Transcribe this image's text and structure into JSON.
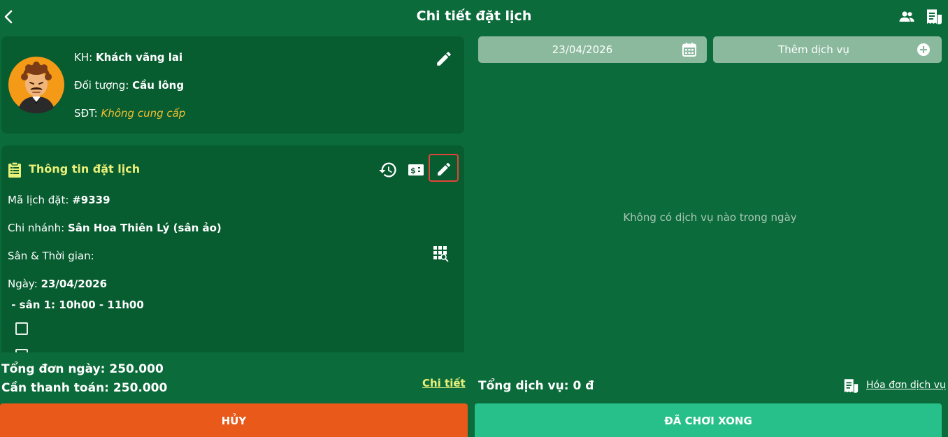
{
  "header": {
    "title": "Chi tiết đặt lịch",
    "icons": [
      "chevron-left-icon",
      "people-icon",
      "receipt-icon"
    ]
  },
  "customer": {
    "name_label": "KH:",
    "name": "Khách vãng lai",
    "type_label": "Đối tượng:",
    "type": "Cầu lông",
    "phone_label": "SĐT:",
    "phone": "Không cung cấp"
  },
  "booking": {
    "section_title": "Thông tin đặt lịch",
    "code_label": "Mã lịch đặt:",
    "code": "#9339",
    "branch_label": "Chi nhánh:",
    "branch": "Sân Hoa Thiên Lý (sân ảo)",
    "court_time_label": "Sân & Thời gian:",
    "date_label": "Ngày:",
    "date": "23/04/2026",
    "slot": " - sân 1: 10h00 - 11h00"
  },
  "totals": {
    "day_total_label": "Tổng đơn ngày:",
    "day_total": "250.000",
    "to_pay_label": "Cần thanh toán:",
    "to_pay": "250.000",
    "detail_link": "Chi tiết"
  },
  "actions": {
    "cancel": "HỦY",
    "done": "ĐÃ CHƠI XONG"
  },
  "services": {
    "date": "23/04/2026",
    "add_label": "Thêm dịch vụ",
    "empty_message": "Không có dịch vụ nào trong ngày",
    "total_label": "Tổng dịch vụ:",
    "total": "0 đ",
    "invoice_link": "Hóa đơn dịch vụ"
  },
  "colors": {
    "background": "#0b6b3a",
    "card": "#075c30",
    "accent_yellow": "#e9f07a",
    "phone_orange": "#f2c033",
    "cancel": "#e8591a",
    "done": "#27c08a",
    "highlight_border": "#e2453a"
  }
}
